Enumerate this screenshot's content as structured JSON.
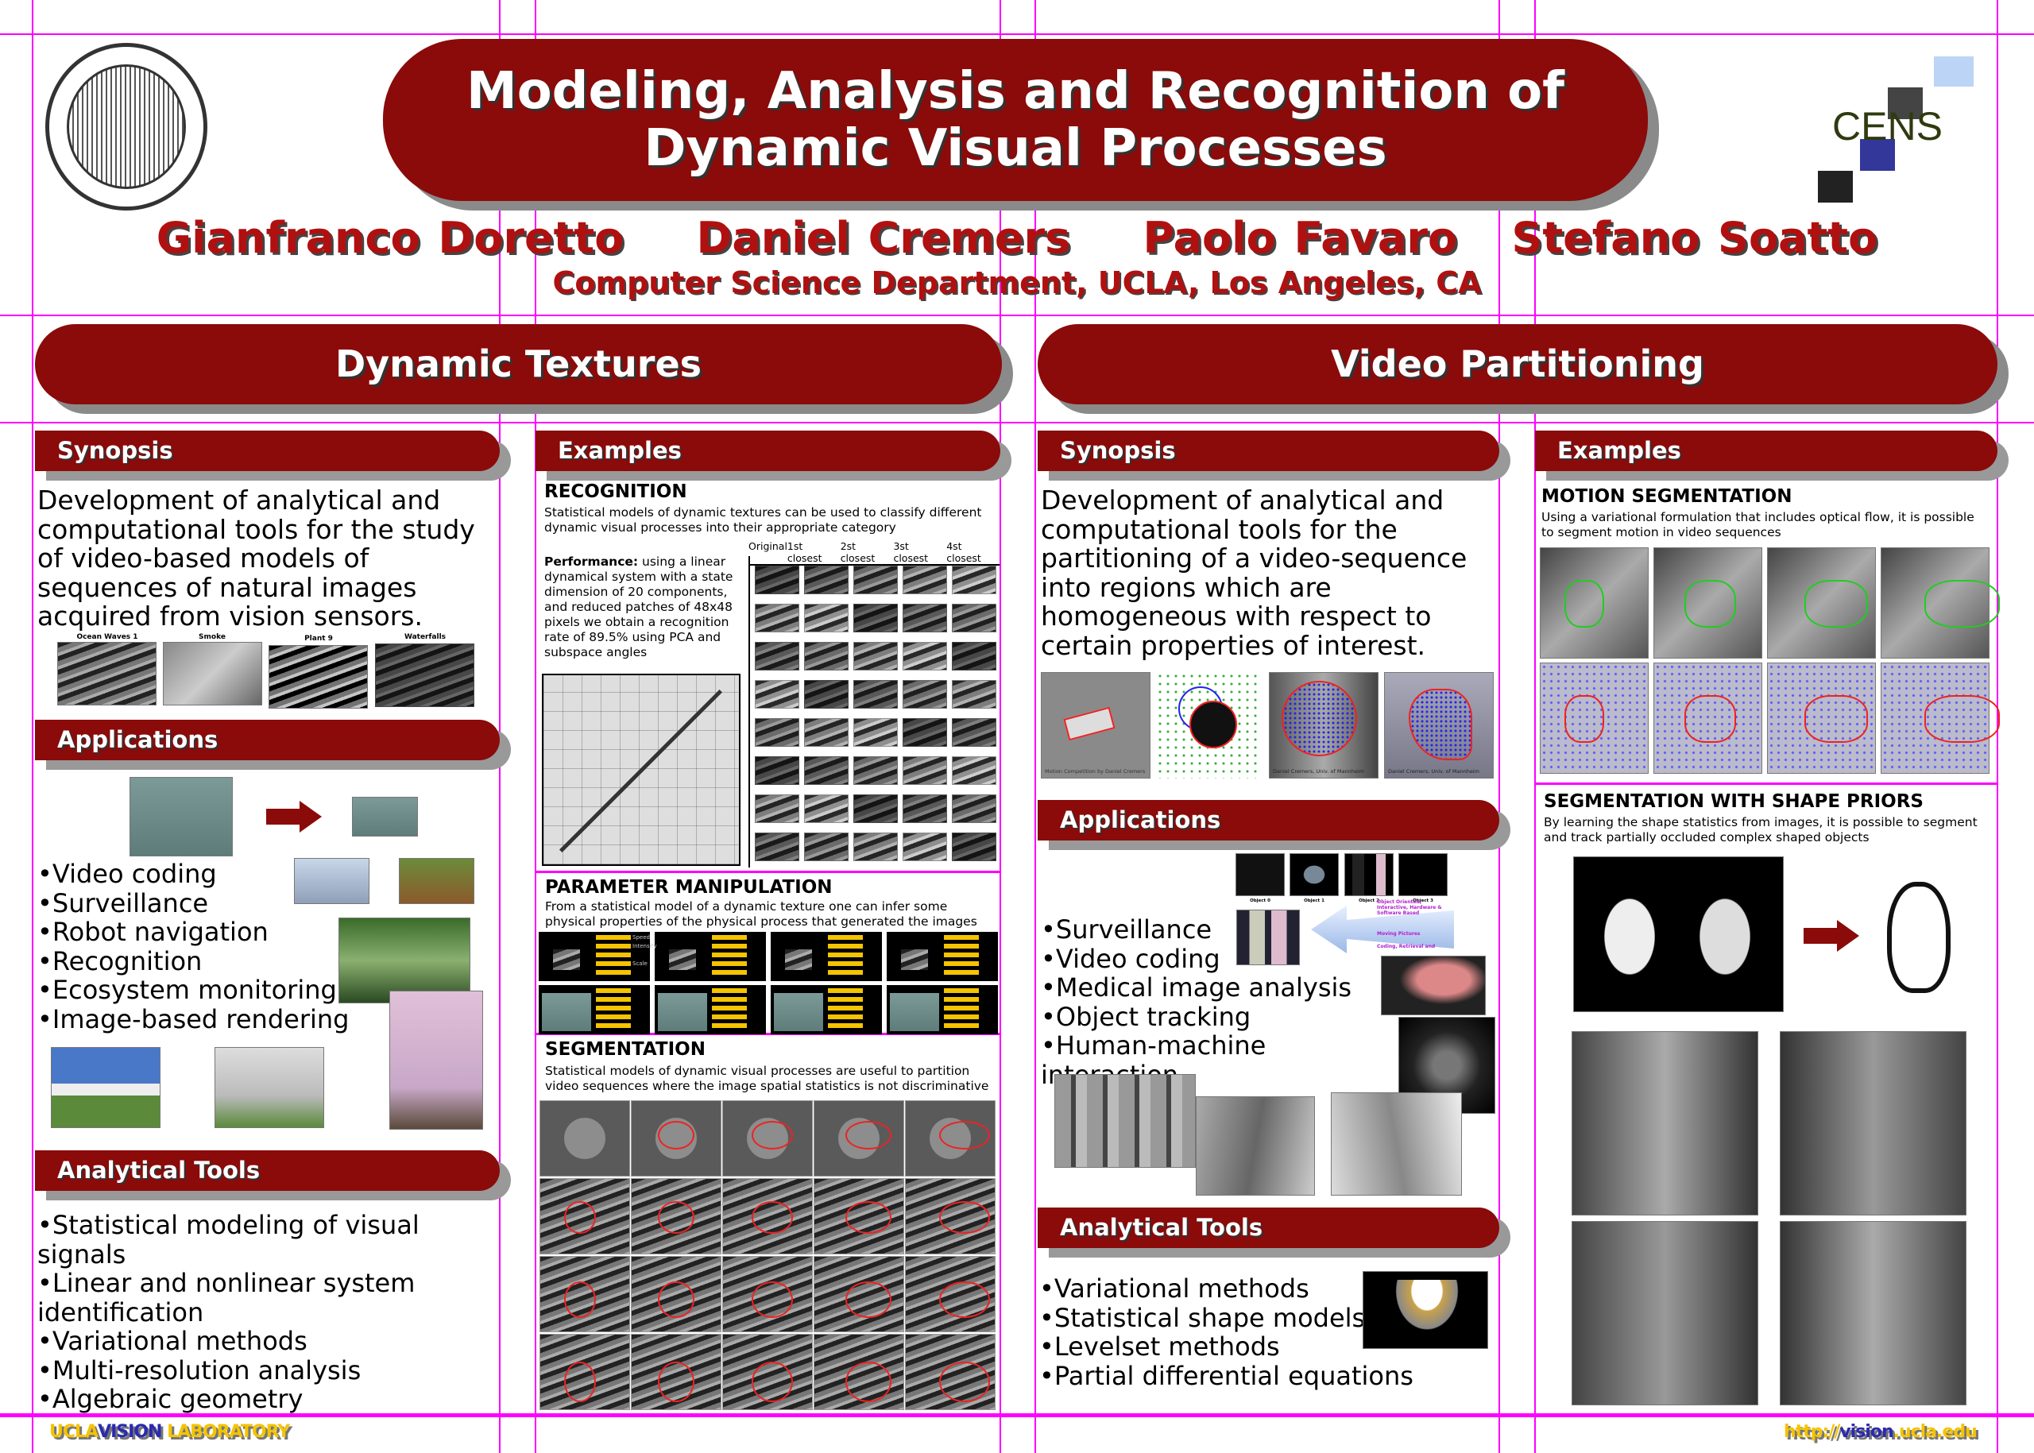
{
  "header": {
    "title_line1": "Modeling, Analysis and Recognition of",
    "title_line2": "Dynamic Visual Processes",
    "authors": [
      "Gianfranco Doretto",
      "Daniel Cremers",
      "Paolo Favaro",
      "Stefano Soatto"
    ],
    "affiliation": "Computer Science Department, UCLA, Los Angeles, CA",
    "left_logo": "THE UNIVERSITY OF CALIFORNIA 1868 LET THERE BE LIGHT",
    "right_logo": "CENS"
  },
  "colors": {
    "banner": "#8b0a0a",
    "grid": "#ff00ff",
    "footer_yellow": "#f5c400",
    "footer_blue": "#2a2ab0"
  },
  "dynamic_textures": {
    "title": "Dynamic Textures",
    "synopsis": {
      "label": "Synopsis",
      "text": "Development of analytical and computational tools for the study of video-based models of sequences of natural images acquired from vision sensors.",
      "captions": [
        "Ocean Waves 1",
        "Smoke",
        "Plant 9",
        "Waterfalls"
      ]
    },
    "applications": {
      "label": "Applications",
      "items": [
        "•Video coding",
        "•Surveillance",
        "•Robot navigation",
        "•Recognition",
        "•Ecosystem monitoring",
        "•Image-based rendering"
      ]
    },
    "tools": {
      "label": "Analytical  Tools",
      "items": [
        "•Statistical modeling of visual signals",
        "•Linear and nonlinear system identification",
        "•Variational methods",
        "•Multi-resolution analysis",
        "•Algebraic geometry"
      ]
    },
    "examples": {
      "label": "Examples",
      "recognition": {
        "title": "RECOGNITION",
        "text": "Statistical models of dynamic textures can be used to classify different dynamic visual processes into their appropriate category",
        "perf_label": "Performance:",
        "perf_text": " using a linear dynamical system with a state dimension of 20 components, and reduced patches of 48x48 pixels we obtain a recognition rate of 89.5% using PCA and subspace angles",
        "columns": [
          "Original",
          "1st closest",
          "2st closest",
          "3st closest",
          "4st closest"
        ]
      },
      "parameter": {
        "title": "PARAMETER MANIPULATION",
        "text": "From a statistical model of a dynamic texture one can infer some physical properties of the physical process that generated the images",
        "labels": [
          "Speed",
          "Intensity",
          "Scale"
        ]
      },
      "segmentation": {
        "title": "SEGMENTATION",
        "text": "Statistical models of dynamic visual processes are useful to partition video sequences where the image spatial statistics is not discriminative"
      }
    }
  },
  "video_partitioning": {
    "title": "Video Partitioning",
    "synopsis": {
      "label": "Synopsis",
      "text": "Development of analytical and computational tools for the partitioning of a video-sequence into regions which are homogeneous with respect to certain properties of interest.",
      "captions": [
        "Motion Competition by Daniel Cremers",
        "Daniel Cremers, Univ. of Mannheim",
        "Daniel Cremers, Univ. of Mannheim"
      ]
    },
    "applications": {
      "label": "Applications",
      "items": [
        "•Surveillance",
        "•Video coding",
        "•Medical image analysis",
        "•Object tracking",
        "•Human-machine interaction"
      ],
      "objects": [
        "Object 0",
        "Object 1",
        "Object 2",
        "Object 3"
      ],
      "arrow_text": [
        "Object Oriented, Interactive, Hardware & Software Based",
        "Moving Pictures",
        "Coding, Retrieval and"
      ]
    },
    "tools": {
      "label": "Analytical  Tools",
      "items": [
        "•Variational methods",
        "•Statistical shape models",
        "•Levelset methods",
        "•Partial differential equations"
      ]
    },
    "examples": {
      "label": "Examples",
      "motion": {
        "title": "MOTION SEGMENTATION",
        "text": "Using a variational formulation that includes optical flow, it is possible to segment motion in video sequences"
      },
      "shape": {
        "title": "SEGMENTATION WITH SHAPE PRIORS",
        "text": "By learning the shape statistics from images, it is possible to segment and track partially occluded complex shaped objects"
      }
    }
  },
  "footer": {
    "left_a": "UCLA",
    "left_b": "VISION",
    "left_c": " LABORATORY",
    "right_a": "http://",
    "right_b": "vision",
    "right_c": ".ucla.edu"
  }
}
